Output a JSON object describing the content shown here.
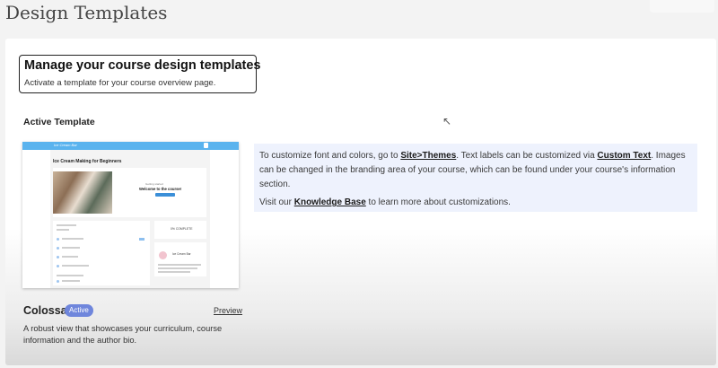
{
  "page": {
    "title": "Design Templates"
  },
  "header": {
    "title": "Manage your course design templates",
    "subtitle": "Activate a template for your course overview page."
  },
  "active_template_label": "Active Template",
  "preview_thumbnail": {
    "site_name": "Ice Cream Bar",
    "course_title": "Ice Cream Making for Beginners",
    "welcome_text": "Welcome to the course!",
    "getting_started": "Getting started",
    "completion": "0% COMPLETE",
    "author_label": "Ice Cream Bar"
  },
  "info": {
    "line1_prefix": "To customize font and colors, go to ",
    "site_themes_link": "Site>Themes",
    "line1_mid": ". Text labels can be customized via ",
    "custom_text_link": "Custom Text",
    "line1_suffix": ". Images can be changed in the branding area of your course, which can be found under your course's information section.",
    "line2_prefix": "Visit our ",
    "knowledge_base_link": "Knowledge Base",
    "line2_suffix": " to learn more about customizations."
  },
  "template": {
    "name": "Colossal",
    "status_badge": "Active",
    "preview_link": "Preview",
    "description": "A robust view that showcases your curriculum, course information and the author bio."
  },
  "icons": {
    "cursor": "mouse-pointer-icon"
  },
  "colors": {
    "badge": "#6f86dc",
    "info_bg": "#eef2fd",
    "thumb_header": "#5ab3ee"
  }
}
